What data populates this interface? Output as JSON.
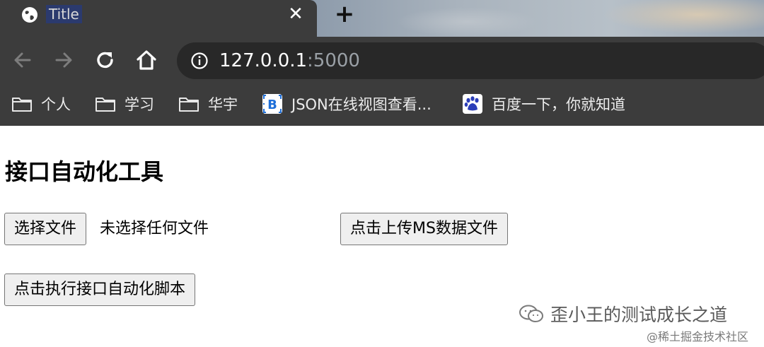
{
  "tab": {
    "title": "Title",
    "favicon": "globe-icon",
    "close_glyph": "✕",
    "new_tab_glyph": "+"
  },
  "toolbar": {
    "back": "arrow-left-icon",
    "forward": "arrow-right-icon",
    "reload": "reload-icon",
    "home": "home-icon",
    "url_host": "127.0.0.1",
    "url_port": ":5000"
  },
  "bookmarks": [
    {
      "label": "个人",
      "icon": "folder-icon"
    },
    {
      "label": "学习",
      "icon": "folder-icon"
    },
    {
      "label": "华宇",
      "icon": "folder-icon"
    },
    {
      "label": "JSON在线视图查看...",
      "icon": "bootstrap-icon"
    },
    {
      "label": "百度一下，你就知道",
      "icon": "baidu-paw-icon"
    }
  ],
  "page": {
    "title": "接口自动化工具",
    "choose_file_label": "选择文件",
    "file_status": "未选择任何文件",
    "upload_label": "点击上传MS数据文件",
    "run_label": "点击执行接口自动化脚本"
  },
  "watermark": {
    "wechat": "歪小王的测试成长之道",
    "site": "@稀土掘金技术社区"
  },
  "colors": {
    "chrome_bg": "#3c3c3c",
    "omnibox_bg": "#282828",
    "button_bg": "#efefef"
  }
}
